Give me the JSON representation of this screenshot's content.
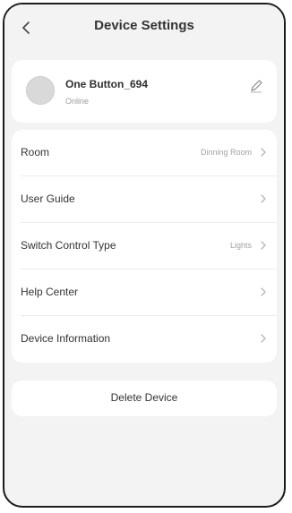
{
  "header": {
    "title": "Device Settings",
    "back_icon": "chevron-left-icon"
  },
  "device": {
    "name": "One Button_694",
    "status": "Online",
    "edit_icon": "pencil-icon"
  },
  "menu": {
    "items": [
      {
        "label": "Room",
        "value": "Dinning Room"
      },
      {
        "label": "User Guide",
        "value": ""
      },
      {
        "label": "Switch Control Type",
        "value": "Lights"
      },
      {
        "label": "Help Center",
        "value": ""
      },
      {
        "label": "Device Information",
        "value": ""
      }
    ]
  },
  "actions": {
    "delete_label": "Delete Device"
  },
  "colors": {
    "background": "#f3f3f3",
    "card": "#ffffff",
    "text": "#333333",
    "muted": "#a2a2a2"
  }
}
